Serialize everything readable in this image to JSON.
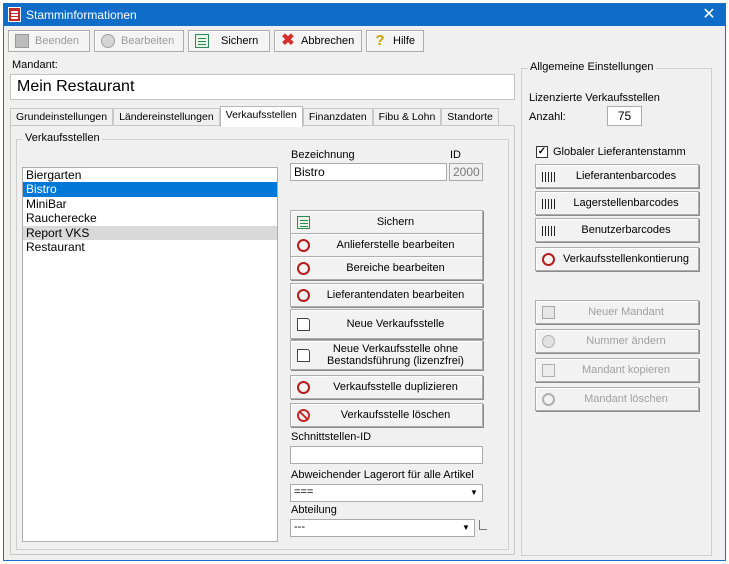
{
  "window": {
    "title": "Stamminformationen",
    "close": "✕"
  },
  "toolbar": {
    "beenden": "Beenden",
    "bearbeiten": "Bearbeiten",
    "sichern": "Sichern",
    "abbrechen": "Abbrechen",
    "hilfe": "Hilfe"
  },
  "mandant": {
    "label": "Mandant:",
    "value": "Mein Restaurant"
  },
  "tabs": [
    "Grundeinstellungen",
    "Ländereinstellungen",
    "Verkaufsstellen",
    "Finanzdaten",
    "Fibu & Lohn",
    "Standorte"
  ],
  "verkaufsstellen": {
    "group_label": "Verkaufsstellen",
    "items": [
      "Biergarten",
      "Bistro",
      "MiniBar",
      "Raucherecke",
      "Report VKS",
      "Restaurant"
    ],
    "selected": "Bistro",
    "highlighted": "Report VKS"
  },
  "detail": {
    "bezeichnung_label": "Bezeichnung",
    "bezeichnung_value": "Bistro",
    "id_label": "ID",
    "id_value": "2000",
    "buttons": {
      "sichern": "Sichern",
      "anlieferstelle": "Anlieferstelle bearbeiten",
      "bereiche": "Bereiche bearbeiten",
      "lieferantendaten": "Lieferantendaten bearbeiten",
      "neue_vks": "Neue Verkaufsstelle",
      "neue_vks_ohne": "Neue Verkaufsstelle ohne Bestandsführung (lizenzfrei)",
      "duplizieren": "Verkaufsstelle duplizieren",
      "loeschen": "Verkaufsstelle löschen"
    },
    "schnittstellen_label": "Schnittstellen-ID",
    "schnittstellen_value": "",
    "lagerort_label": "Abweichender Lagerort für alle Artikel",
    "lagerort_value": "===",
    "abteilung_label": "Abteilung",
    "abteilung_value": "---"
  },
  "allgemein": {
    "group_label": "Allgemeine Einstellungen",
    "lizenz_label": "Lizenzierte Verkaufsstellen",
    "anzahl_label": "Anzahl:",
    "anzahl_value": "75",
    "global_label": "Globaler Lieferantenstamm",
    "global_checked": "✓",
    "lieferantenbarcodes": "Lieferantenbarcodes",
    "lagerstellenbarcodes": "Lagerstellenbarcodes",
    "benutzerbarcodes": "Benutzerbarcodes",
    "kontierung": "Verkaufsstellenkontierung",
    "neuer_mandant": "Neuer Mandant",
    "nummer_aendern": "Nummer ändern",
    "mandant_kopieren": "Mandant kopieren",
    "mandant_loeschen": "Mandant löschen"
  }
}
